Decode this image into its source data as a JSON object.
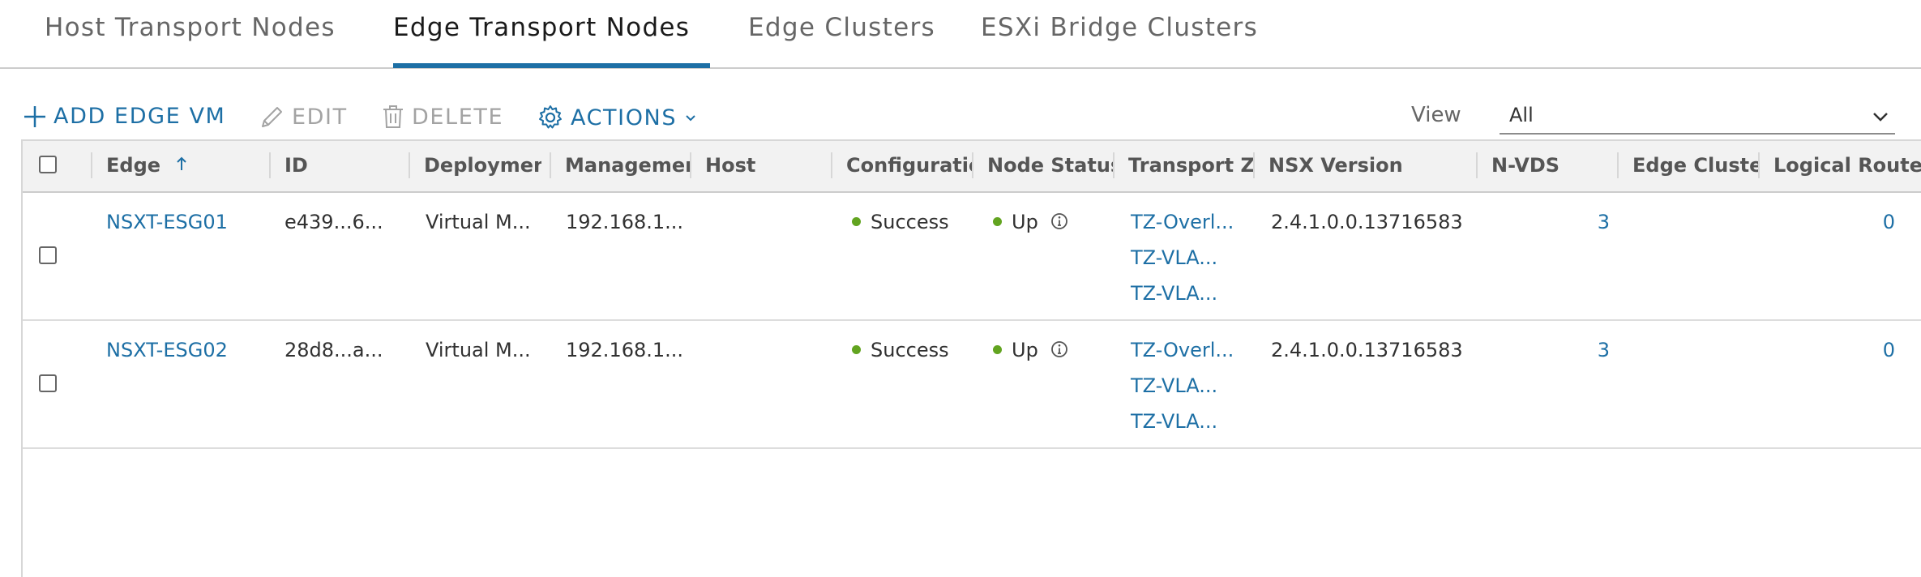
{
  "tabs": [
    {
      "label": "Host Transport Nodes"
    },
    {
      "label": "Edge Transport Nodes"
    },
    {
      "label": "Edge Clusters"
    },
    {
      "label": "ESXi Bridge Clusters"
    }
  ],
  "active_tab": "Edge Transport Nodes",
  "toolbar": {
    "add_label": "ADD EDGE VM",
    "edit_label": "EDIT",
    "delete_label": "DELETE",
    "actions_label": "ACTIONS"
  },
  "view": {
    "label": "View",
    "value": "All"
  },
  "columns": {
    "edge": "Edge",
    "id": "ID",
    "deployment": "Deployment",
    "management": "Management",
    "host": "Host",
    "configuration": "Configuration",
    "node_status": "Node Status",
    "transport_zones": "Transport Zo",
    "nsx_version": "NSX Version",
    "nvds": "N-VDS",
    "edge_cluster": "Edge Cluster",
    "logical_routers": "Logical Route"
  },
  "rows": [
    {
      "edge": "NSXT-ESG01",
      "id": "e439...6...",
      "deployment": "Virtual M...",
      "management": "192.168.1...",
      "host": "",
      "configuration": "Success",
      "node_status": "Up",
      "transport_zones": [
        "TZ-Overl...",
        "TZ-VLA...",
        "TZ-VLA..."
      ],
      "nsx_version": "2.4.1.0.0.13716583",
      "nvds": "3",
      "edge_cluster": "",
      "logical_routers": "0"
    },
    {
      "edge": "NSXT-ESG02",
      "id": "28d8...a...",
      "deployment": "Virtual M...",
      "management": "192.168.1...",
      "host": "",
      "configuration": "Success",
      "node_status": "Up",
      "transport_zones": [
        "TZ-Overl...",
        "TZ-VLA...",
        "TZ-VLA..."
      ],
      "nsx_version": "2.4.1.0.0.13716583",
      "nvds": "3",
      "edge_cluster": "",
      "logical_routers": "0"
    }
  ],
  "colors": {
    "accent": "#1d6fa5",
    "success": "#62a420",
    "disabled": "#a3a3a3"
  },
  "icons": [
    "plus-icon",
    "pencil-icon",
    "trash-icon",
    "gear-icon",
    "chevron-down-icon",
    "sort-ascending-icon",
    "info-icon"
  ]
}
